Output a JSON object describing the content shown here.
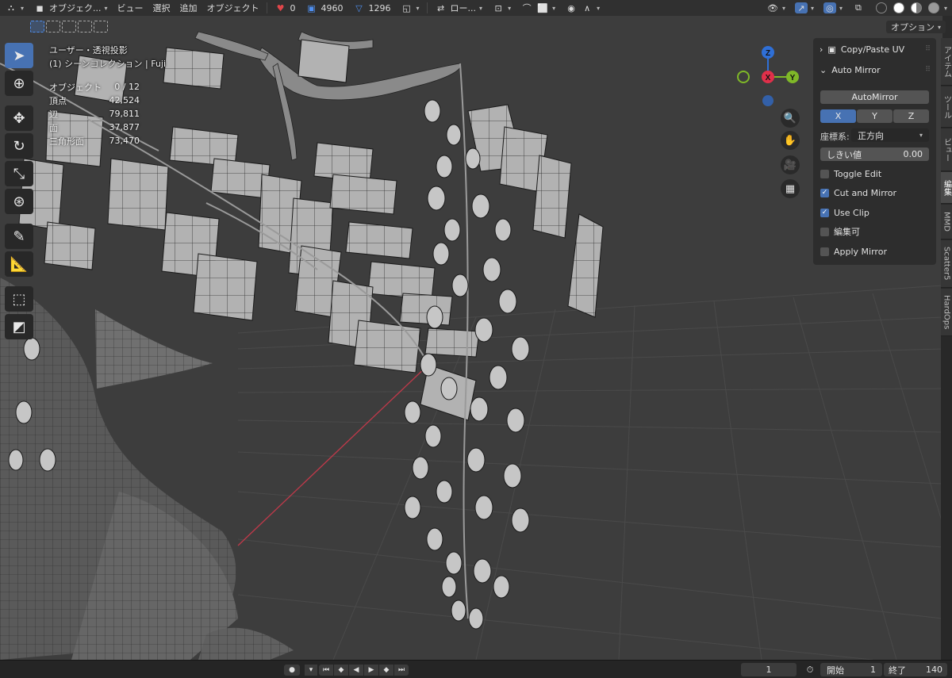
{
  "header": {
    "mode_label": "オブジェク...",
    "menus": [
      "ビュー",
      "選択",
      "追加",
      "オブジェクト"
    ],
    "counters": [
      {
        "icon": "heart-icon",
        "value": "0",
        "color": "#e0464a"
      },
      {
        "icon": "face-select-icon",
        "value": "4960",
        "color": "#4f8ff0"
      },
      {
        "icon": "vertex-icon",
        "value": "1296",
        "color": "#4f8ff0"
      }
    ],
    "transform_orientation": "ロー...",
    "options_label": "オプション"
  },
  "overlay": {
    "view_name": "ユーザー・透視投影",
    "collection": "(1) シーンコレクション | Fuji",
    "stats": [
      {
        "label": "オブジェクト",
        "value": "0 / 12"
      },
      {
        "label": "頂点",
        "value": "42,524"
      },
      {
        "label": "辺",
        "value": "79,811"
      },
      {
        "label": "面",
        "value": "37,877"
      },
      {
        "label": "三角形面",
        "value": "73,470"
      }
    ]
  },
  "gizmo": {
    "axes": [
      {
        "label": "Z",
        "color": "#2f6fd6"
      },
      {
        "label": "X",
        "color": "#e0304a"
      },
      {
        "label": "Y",
        "color": "#7fb828"
      }
    ]
  },
  "toolbar": {
    "tools": [
      "select-box-icon",
      "cursor-icon",
      "move-icon",
      "rotate-icon",
      "scale-icon",
      "transform-icon",
      "annotate-icon",
      "measure-icon",
      "add-cube-icon",
      "bevel-icon"
    ]
  },
  "npanel": {
    "copy_paste_title": "Copy/Paste UV",
    "auto_mirror_title": "Auto Mirror",
    "automirror_button": "AutoMirror",
    "axes": [
      "X",
      "Y",
      "Z"
    ],
    "active_axis": "X",
    "orientation_label": "座標系:",
    "orientation_value": "正方向",
    "threshold_label": "しきい値",
    "threshold_value": "0.00",
    "checks": [
      {
        "label": "Toggle Edit",
        "checked": false
      },
      {
        "label": "Cut and Mirror",
        "checked": true
      },
      {
        "label": "Use Clip",
        "checked": true
      },
      {
        "label": "編集可",
        "checked": false
      },
      {
        "label": "Apply Mirror",
        "checked": false
      }
    ]
  },
  "side_tabs": [
    "アイテム",
    "ツール",
    "ビュー",
    "編集",
    "MMD",
    "Scatter5",
    "HardOps"
  ],
  "timeline": {
    "current_frame": "1",
    "start_label": "開始",
    "start_value": "1",
    "end_label": "終了",
    "end_value": "140"
  }
}
